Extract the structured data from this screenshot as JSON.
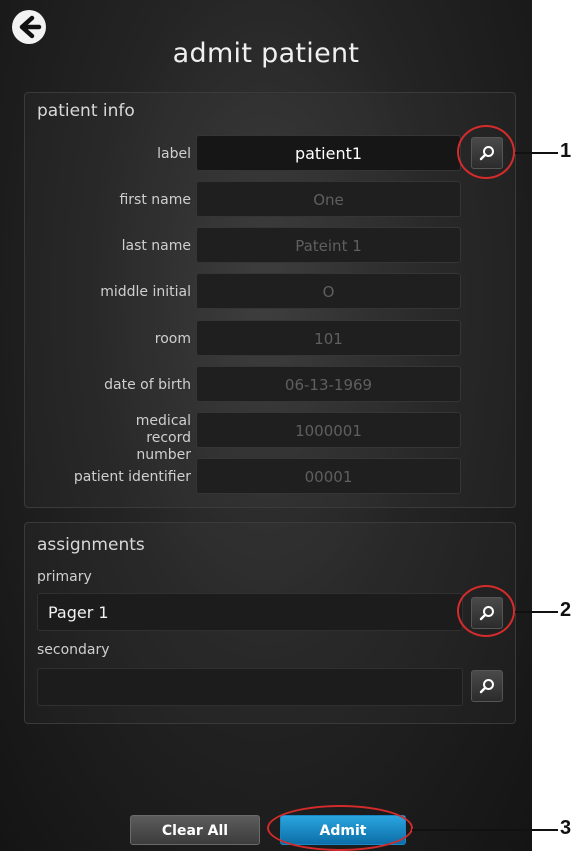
{
  "header": {
    "title": "admit patient",
    "back_icon": "arrow-left-circle-icon"
  },
  "patient_info": {
    "title": "patient info",
    "fields": [
      {
        "label": "label",
        "value": "patient1",
        "active": true
      },
      {
        "label": "first name",
        "value": "One"
      },
      {
        "label": "last name",
        "value": "Pateint 1"
      },
      {
        "label": "middle initial",
        "value": "O"
      },
      {
        "label": "room",
        "value": "101"
      },
      {
        "label": "date of birth",
        "value": "06-13-1969"
      },
      {
        "label": "medical record number",
        "value": "1000001"
      },
      {
        "label": "patient identifier",
        "value": "00001"
      }
    ],
    "search_icon": "search-icon"
  },
  "assignments": {
    "title": "assignments",
    "primary_label": "primary",
    "primary_value": "Pager 1",
    "secondary_label": "secondary",
    "secondary_value": ""
  },
  "buttons": {
    "clear_all": "Clear All",
    "admit": "Admit"
  },
  "callouts": {
    "one": "1",
    "two": "2",
    "three": "3"
  },
  "colors": {
    "admit_blue": "#1a87c4",
    "callout_red": "#d52b2b",
    "background": "#242424"
  }
}
